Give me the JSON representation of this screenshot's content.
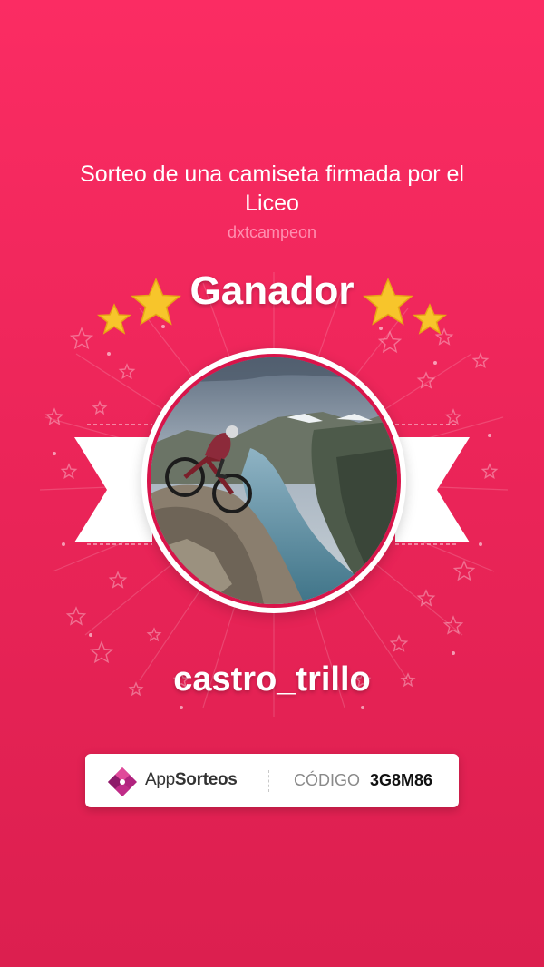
{
  "raffle": {
    "title": "Sorteo de una camiseta firmada por el Liceo",
    "organizer": "dxtcampeon",
    "heading": "Ganador",
    "winner": "castro_trillo"
  },
  "badge": {
    "brand_prefix": "App",
    "brand_suffix": "Sorteos",
    "code_label": "CÓDIGO",
    "code_value": "3G8M86"
  },
  "icons": {
    "stars": "star-icon",
    "logo": "appsorteos-logo-icon",
    "photo": "winner-avatar-mountain-biker"
  },
  "colors": {
    "background": "#ec2559",
    "ring": "#d8144a",
    "star": "#f7c52b",
    "logo": "#b1237e"
  }
}
